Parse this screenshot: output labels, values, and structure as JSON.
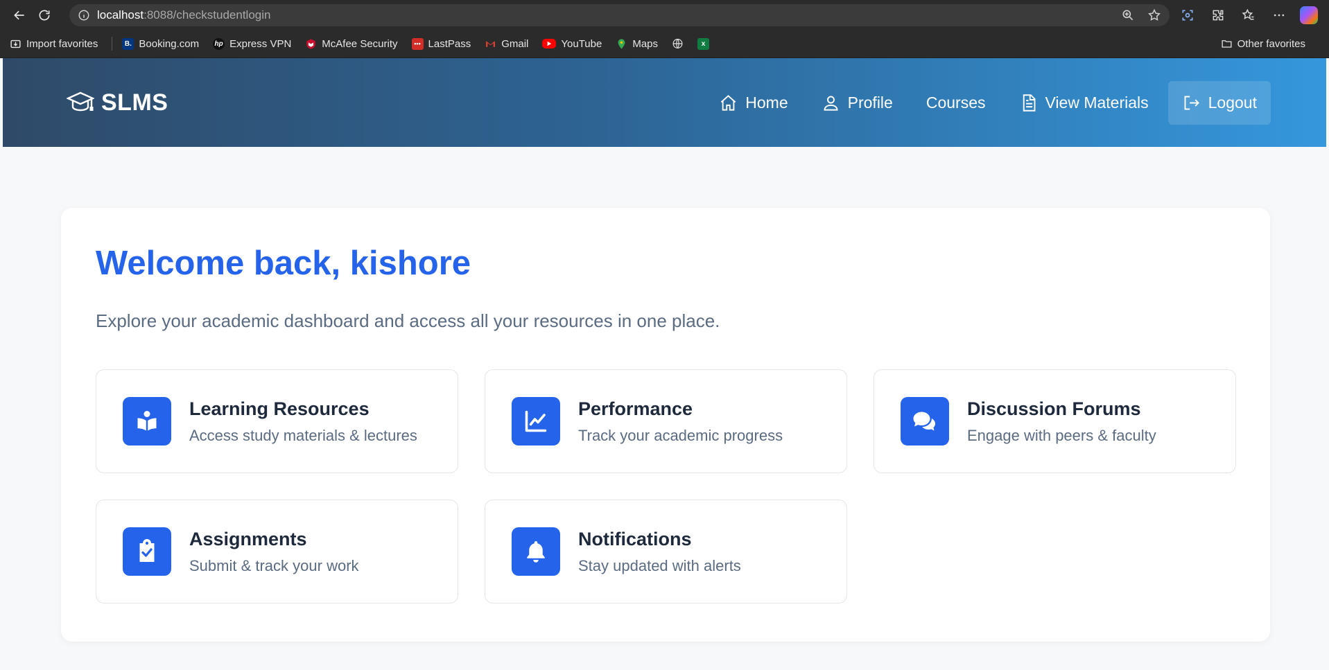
{
  "browser": {
    "url_host": "localhost",
    "url_rest": ":8088/checkstudentlogin",
    "bookmarks": [
      {
        "label": "Import favorites",
        "icon": "import-icon"
      },
      {
        "label": "Booking.com",
        "icon": "booking-icon"
      },
      {
        "label": "Express VPN",
        "icon": "hp-icon"
      },
      {
        "label": "McAfee Security",
        "icon": "mcafee-icon"
      },
      {
        "label": "LastPass",
        "icon": "lastpass-icon"
      },
      {
        "label": "Gmail",
        "icon": "gmail-icon"
      },
      {
        "label": "YouTube",
        "icon": "youtube-icon"
      },
      {
        "label": "Maps",
        "icon": "maps-icon"
      }
    ],
    "other_favorites": "Other favorites"
  },
  "header": {
    "brand": "SLMS",
    "nav": {
      "home": "Home",
      "profile": "Profile",
      "courses": "Courses",
      "view_materials": "View Materials",
      "logout": "Logout"
    }
  },
  "main": {
    "welcome": "Welcome back, kishore",
    "subtitle": "Explore your academic dashboard and access all your resources in one place.",
    "tiles": [
      {
        "title": "Learning Resources",
        "desc": "Access study materials & lectures",
        "icon": "book-reader-icon"
      },
      {
        "title": "Performance",
        "desc": "Track your academic progress",
        "icon": "chart-line-icon"
      },
      {
        "title": "Discussion Forums",
        "desc": "Engage with peers & faculty",
        "icon": "comments-icon"
      },
      {
        "title": "Assignments",
        "desc": "Submit & track your work",
        "icon": "clipboard-check-icon"
      },
      {
        "title": "Notifications",
        "desc": "Stay updated with alerts",
        "icon": "bell-icon"
      }
    ]
  },
  "colors": {
    "accent": "#2563eb",
    "header_start": "#2f4a68",
    "header_end": "#3597dc",
    "title_text": "#1e293b",
    "muted_text": "#5b6b82"
  }
}
